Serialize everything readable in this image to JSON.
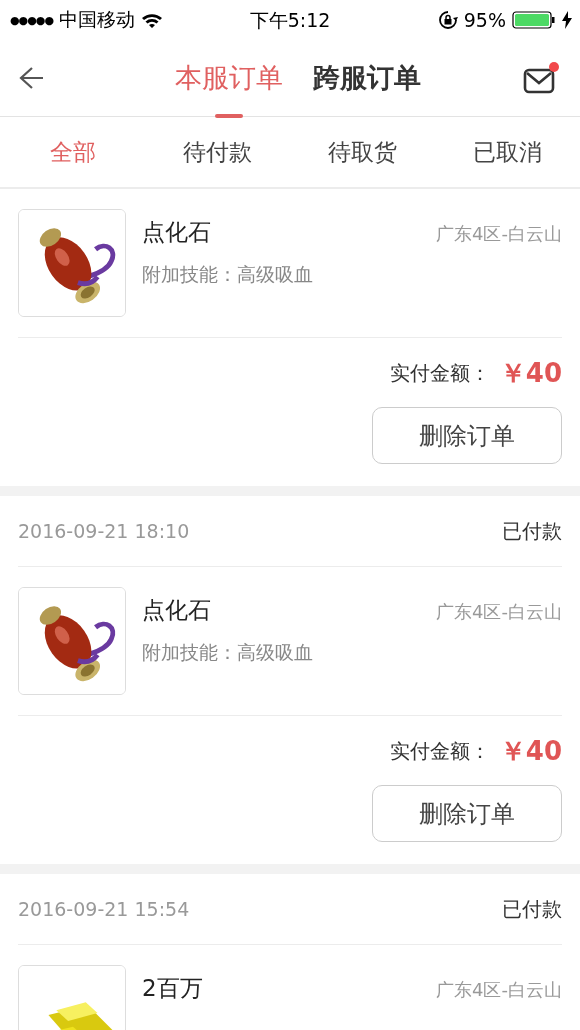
{
  "status_bar": {
    "signal": "●●●●●",
    "carrier": "中国移动",
    "time": "下午5:12",
    "battery": "95%"
  },
  "header": {
    "tabs": [
      {
        "label": "本服订单",
        "selected": true
      },
      {
        "label": "跨服订单",
        "selected": false
      }
    ],
    "mail_unread": true
  },
  "filters": [
    {
      "label": "全部",
      "selected": true
    },
    {
      "label": "待付款",
      "selected": false
    },
    {
      "label": "待取货",
      "selected": false
    },
    {
      "label": "已取消",
      "selected": false
    }
  ],
  "orders": [
    {
      "item": {
        "name": "点化石",
        "detail": "附加技能：高级吸血",
        "region": "广东4区-白云山"
      },
      "amount_label": "实付金额：",
      "amount": "￥40",
      "action": "删除订单"
    },
    {
      "date": "2016-09-21 18:10",
      "status": "已付款",
      "item": {
        "name": "点化石",
        "detail": "附加技能：高级吸血",
        "region": "广东4区-白云山"
      },
      "amount_label": "实付金额：",
      "amount": "￥40",
      "action": "删除订单"
    },
    {
      "date": "2016-09-21 15:54",
      "status": "已付款",
      "item": {
        "name": "2百万",
        "region": "广东4区-白云山"
      }
    }
  ]
}
